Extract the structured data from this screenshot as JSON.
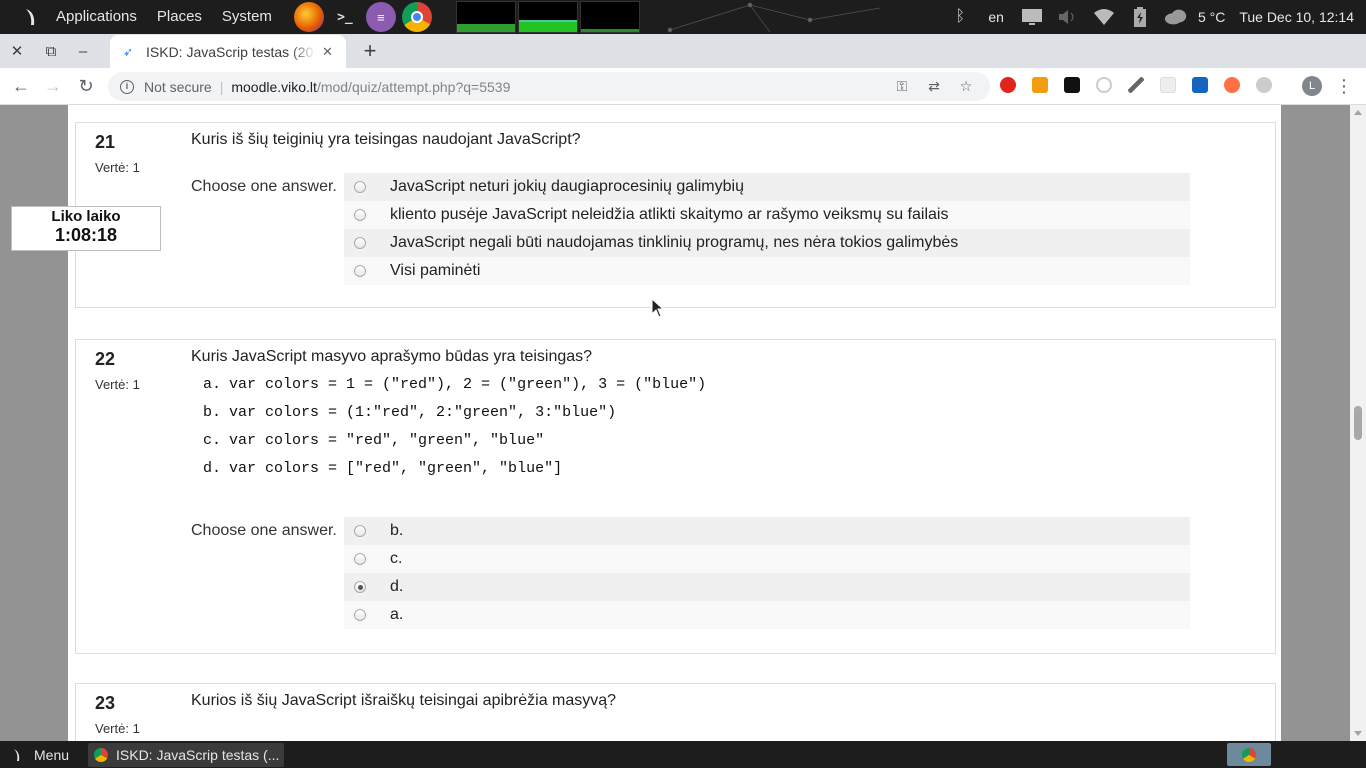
{
  "top_panel": {
    "menus": [
      "Applications",
      "Places",
      "System"
    ],
    "language": "en",
    "temperature": "5 °C",
    "clock": "Tue Dec 10, 12:14"
  },
  "browser": {
    "tab_title": "ISKD: JavaScrip testas (20",
    "not_secure_label": "Not secure",
    "url_host": "moodle.viko.lt",
    "url_path": "/mod/quiz/attempt.php?q=5539",
    "profile_initial": "L"
  },
  "timer": {
    "label": "Liko laiko",
    "value": "1:08:18"
  },
  "questions": [
    {
      "number": "21",
      "grade": "Vertė: 1",
      "text": "Kuris iš šių teiginių yra teisingas naudojant JavaScript?",
      "choose_label": "Choose one answer.",
      "answers": [
        {
          "label": "JavaScript neturi jokių daugiaprocesinių galimybių",
          "checked": false
        },
        {
          "label": "kliento pusėje JavaScript neleidžia atlikti skaitymo ar rašymo veiksmų su failais",
          "checked": false
        },
        {
          "label": "JavaScript negali būti naudojamas tinklinių programų, nes nėra tokios galimybės",
          "checked": false
        },
        {
          "label": "Visi paminėti",
          "checked": false
        }
      ]
    },
    {
      "number": "22",
      "grade": "Vertė: 1",
      "text": "Kuris JavaScript masyvo aprašymo būdas yra teisingas?",
      "code_options": [
        {
          "label": "a.",
          "code": "var colors = 1 = (\"red\"), 2 = (\"green\"), 3 = (\"blue\")"
        },
        {
          "label": "b.",
          "code": "var colors = (1:\"red\", 2:\"green\", 3:\"blue\")"
        },
        {
          "label": "c.",
          "code": "var colors = \"red\", \"green\", \"blue\""
        },
        {
          "label": "d.",
          "code": "var colors = [\"red\", \"green\", \"blue\"]"
        }
      ],
      "choose_label": "Choose one answer.",
      "answers": [
        {
          "label": "b.",
          "checked": false
        },
        {
          "label": "c.",
          "checked": false
        },
        {
          "label": "d.",
          "checked": true
        },
        {
          "label": "a.",
          "checked": false
        }
      ]
    },
    {
      "number": "23",
      "grade": "Vertė: 1",
      "text": "Kurios iš šių JavaScript išraiškų teisingai apibrėžia masyvą?"
    }
  ],
  "taskbar": {
    "menu_label": "Menu",
    "window_title": "ISKD: JavaScrip testas (..."
  }
}
